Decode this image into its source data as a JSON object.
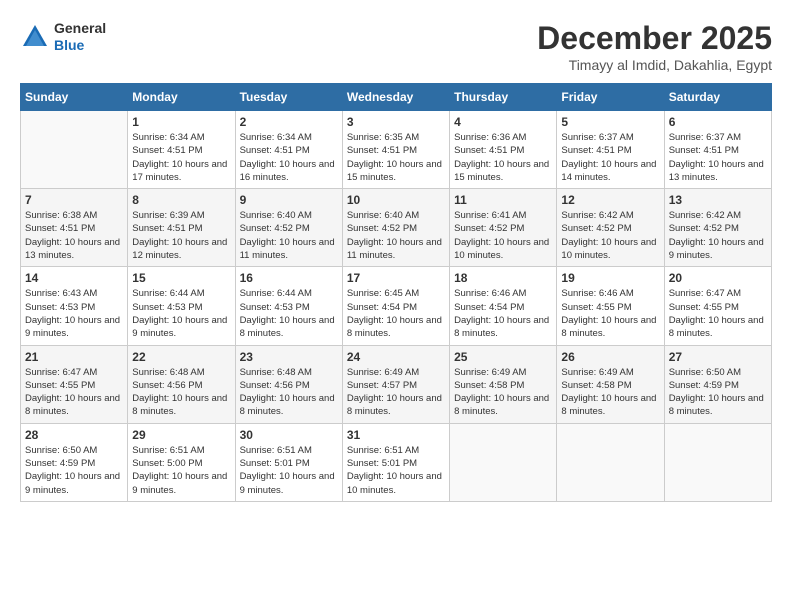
{
  "header": {
    "logo_general": "General",
    "logo_blue": "Blue",
    "month_title": "December 2025",
    "location": "Timayy al Imdid, Dakahlia, Egypt"
  },
  "weekdays": [
    "Sunday",
    "Monday",
    "Tuesday",
    "Wednesday",
    "Thursday",
    "Friday",
    "Saturday"
  ],
  "weeks": [
    [
      {
        "day": "",
        "sunrise": "",
        "sunset": "",
        "daylight": ""
      },
      {
        "day": "1",
        "sunrise": "Sunrise: 6:34 AM",
        "sunset": "Sunset: 4:51 PM",
        "daylight": "Daylight: 10 hours and 17 minutes."
      },
      {
        "day": "2",
        "sunrise": "Sunrise: 6:34 AM",
        "sunset": "Sunset: 4:51 PM",
        "daylight": "Daylight: 10 hours and 16 minutes."
      },
      {
        "day": "3",
        "sunrise": "Sunrise: 6:35 AM",
        "sunset": "Sunset: 4:51 PM",
        "daylight": "Daylight: 10 hours and 15 minutes."
      },
      {
        "day": "4",
        "sunrise": "Sunrise: 6:36 AM",
        "sunset": "Sunset: 4:51 PM",
        "daylight": "Daylight: 10 hours and 15 minutes."
      },
      {
        "day": "5",
        "sunrise": "Sunrise: 6:37 AM",
        "sunset": "Sunset: 4:51 PM",
        "daylight": "Daylight: 10 hours and 14 minutes."
      },
      {
        "day": "6",
        "sunrise": "Sunrise: 6:37 AM",
        "sunset": "Sunset: 4:51 PM",
        "daylight": "Daylight: 10 hours and 13 minutes."
      }
    ],
    [
      {
        "day": "7",
        "sunrise": "Sunrise: 6:38 AM",
        "sunset": "Sunset: 4:51 PM",
        "daylight": "Daylight: 10 hours and 13 minutes."
      },
      {
        "day": "8",
        "sunrise": "Sunrise: 6:39 AM",
        "sunset": "Sunset: 4:51 PM",
        "daylight": "Daylight: 10 hours and 12 minutes."
      },
      {
        "day": "9",
        "sunrise": "Sunrise: 6:40 AM",
        "sunset": "Sunset: 4:52 PM",
        "daylight": "Daylight: 10 hours and 11 minutes."
      },
      {
        "day": "10",
        "sunrise": "Sunrise: 6:40 AM",
        "sunset": "Sunset: 4:52 PM",
        "daylight": "Daylight: 10 hours and 11 minutes."
      },
      {
        "day": "11",
        "sunrise": "Sunrise: 6:41 AM",
        "sunset": "Sunset: 4:52 PM",
        "daylight": "Daylight: 10 hours and 10 minutes."
      },
      {
        "day": "12",
        "sunrise": "Sunrise: 6:42 AM",
        "sunset": "Sunset: 4:52 PM",
        "daylight": "Daylight: 10 hours and 10 minutes."
      },
      {
        "day": "13",
        "sunrise": "Sunrise: 6:42 AM",
        "sunset": "Sunset: 4:52 PM",
        "daylight": "Daylight: 10 hours and 9 minutes."
      }
    ],
    [
      {
        "day": "14",
        "sunrise": "Sunrise: 6:43 AM",
        "sunset": "Sunset: 4:53 PM",
        "daylight": "Daylight: 10 hours and 9 minutes."
      },
      {
        "day": "15",
        "sunrise": "Sunrise: 6:44 AM",
        "sunset": "Sunset: 4:53 PM",
        "daylight": "Daylight: 10 hours and 9 minutes."
      },
      {
        "day": "16",
        "sunrise": "Sunrise: 6:44 AM",
        "sunset": "Sunset: 4:53 PM",
        "daylight": "Daylight: 10 hours and 8 minutes."
      },
      {
        "day": "17",
        "sunrise": "Sunrise: 6:45 AM",
        "sunset": "Sunset: 4:54 PM",
        "daylight": "Daylight: 10 hours and 8 minutes."
      },
      {
        "day": "18",
        "sunrise": "Sunrise: 6:46 AM",
        "sunset": "Sunset: 4:54 PM",
        "daylight": "Daylight: 10 hours and 8 minutes."
      },
      {
        "day": "19",
        "sunrise": "Sunrise: 6:46 AM",
        "sunset": "Sunset: 4:55 PM",
        "daylight": "Daylight: 10 hours and 8 minutes."
      },
      {
        "day": "20",
        "sunrise": "Sunrise: 6:47 AM",
        "sunset": "Sunset: 4:55 PM",
        "daylight": "Daylight: 10 hours and 8 minutes."
      }
    ],
    [
      {
        "day": "21",
        "sunrise": "Sunrise: 6:47 AM",
        "sunset": "Sunset: 4:55 PM",
        "daylight": "Daylight: 10 hours and 8 minutes."
      },
      {
        "day": "22",
        "sunrise": "Sunrise: 6:48 AM",
        "sunset": "Sunset: 4:56 PM",
        "daylight": "Daylight: 10 hours and 8 minutes."
      },
      {
        "day": "23",
        "sunrise": "Sunrise: 6:48 AM",
        "sunset": "Sunset: 4:56 PM",
        "daylight": "Daylight: 10 hours and 8 minutes."
      },
      {
        "day": "24",
        "sunrise": "Sunrise: 6:49 AM",
        "sunset": "Sunset: 4:57 PM",
        "daylight": "Daylight: 10 hours and 8 minutes."
      },
      {
        "day": "25",
        "sunrise": "Sunrise: 6:49 AM",
        "sunset": "Sunset: 4:58 PM",
        "daylight": "Daylight: 10 hours and 8 minutes."
      },
      {
        "day": "26",
        "sunrise": "Sunrise: 6:49 AM",
        "sunset": "Sunset: 4:58 PM",
        "daylight": "Daylight: 10 hours and 8 minutes."
      },
      {
        "day": "27",
        "sunrise": "Sunrise: 6:50 AM",
        "sunset": "Sunset: 4:59 PM",
        "daylight": "Daylight: 10 hours and 8 minutes."
      }
    ],
    [
      {
        "day": "28",
        "sunrise": "Sunrise: 6:50 AM",
        "sunset": "Sunset: 4:59 PM",
        "daylight": "Daylight: 10 hours and 9 minutes."
      },
      {
        "day": "29",
        "sunrise": "Sunrise: 6:51 AM",
        "sunset": "Sunset: 5:00 PM",
        "daylight": "Daylight: 10 hours and 9 minutes."
      },
      {
        "day": "30",
        "sunrise": "Sunrise: 6:51 AM",
        "sunset": "Sunset: 5:01 PM",
        "daylight": "Daylight: 10 hours and 9 minutes."
      },
      {
        "day": "31",
        "sunrise": "Sunrise: 6:51 AM",
        "sunset": "Sunset: 5:01 PM",
        "daylight": "Daylight: 10 hours and 10 minutes."
      },
      {
        "day": "",
        "sunrise": "",
        "sunset": "",
        "daylight": ""
      },
      {
        "day": "",
        "sunrise": "",
        "sunset": "",
        "daylight": ""
      },
      {
        "day": "",
        "sunrise": "",
        "sunset": "",
        "daylight": ""
      }
    ]
  ]
}
